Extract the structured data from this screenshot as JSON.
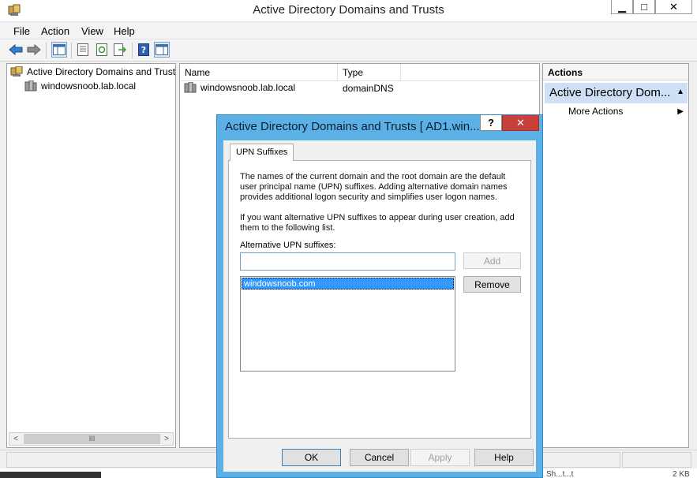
{
  "window": {
    "title": "Active Directory Domains and Trusts",
    "minimize_glyph": "▁",
    "maximize_glyph": "□",
    "close_glyph": "✕"
  },
  "menu": {
    "items": [
      "File",
      "Action",
      "View",
      "Help"
    ]
  },
  "toolbar": {
    "icons": [
      "back-arrow-icon",
      "forward-arrow-icon",
      "show-hide-console-tree-icon",
      "properties-icon",
      "refresh-icon",
      "export-list-icon",
      "help-icon",
      "show-hide-action-pane-icon"
    ]
  },
  "tree": {
    "root_label": "Active Directory Domains and Trust",
    "child_label": "windowsnoob.lab.local"
  },
  "list": {
    "columns": [
      "Name",
      "Type"
    ],
    "rows": [
      {
        "name": "windowsnoob.lab.local",
        "type": "domainDNS"
      }
    ]
  },
  "actions": {
    "header": "Actions",
    "section_title": "Active Directory Dom...",
    "more_actions": "More Actions"
  },
  "scrollbar": {
    "left_arrow": "<",
    "right_arrow": ">",
    "thumb_grip": "III"
  },
  "background": {
    "status_left": "Sh...t...t",
    "status_right": "2 KB"
  },
  "dialog": {
    "title": "Active Directory Domains and Trusts [ AD1.win...",
    "help_glyph": "?",
    "close_glyph": "✕",
    "tab_label": "UPN Suffixes",
    "description": "The names of the current domain and the root domain are the default user principal name (UPN) suffixes. Adding alternative domain names provides additional logon security and simplifies user logon names.",
    "instruction": "If you want alternative UPN suffixes to appear during user creation, add them to the following list.",
    "alt_label": "Alternative UPN suffixes:",
    "input_value": "",
    "add_label": "Add",
    "remove_label": "Remove",
    "suffixes": [
      "windowsnoob.com"
    ],
    "ok_label": "OK",
    "cancel_label": "Cancel",
    "apply_label": "Apply",
    "help_label": "Help"
  },
  "colors": {
    "dialog_frame": "#5bb0e5",
    "close_red": "#c7403a",
    "selection_blue": "#3399ff",
    "actions_highlight": "#cde0f5"
  }
}
